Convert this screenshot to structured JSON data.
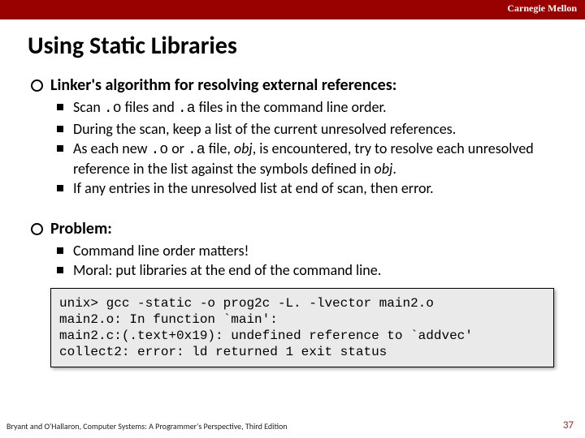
{
  "brand": "Carnegie Mellon",
  "title": "Using Static Libraries",
  "section1": {
    "heading": "Linker's algorithm for resolving external references:",
    "b1_a": "Scan ",
    "b1_code1": ".o",
    "b1_b": " files and ",
    "b1_code2": ".a",
    "b1_c": " files in the command line order.",
    "b2": "During the scan, keep a list of the current unresolved references.",
    "b3_a": "As each new ",
    "b3_code1": ".o",
    "b3_b": " or ",
    "b3_code2": ".a",
    "b3_c": " file, ",
    "b3_obj1": "obj",
    "b3_d": ", is encountered, try to resolve each unresolved reference in the list against the symbols defined in ",
    "b3_obj2": "obj",
    "b3_e": ".",
    "b4": "If any entries in the unresolved list at end of scan, then error."
  },
  "section2": {
    "heading": "Problem:",
    "b1": "Command line order matters!",
    "b2": "Moral: put libraries at the end of the command line."
  },
  "code": "unix> gcc -static -o prog2c -L. -lvector main2.o\nmain2.o: In function `main':\nmain2.c:(.text+0x19): undefined reference to `addvec'\ncollect2: error: ld returned 1 exit status",
  "footer": "Bryant and O'Hallaron, Computer Systems: A Programmer's Perspective, Third Edition",
  "pagenum": "37"
}
